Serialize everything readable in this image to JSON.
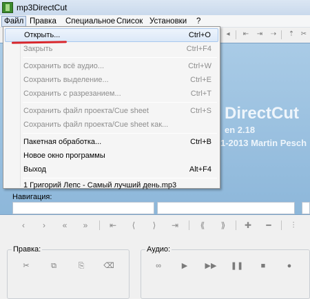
{
  "window": {
    "title": "mp3DirectCut"
  },
  "menubar": {
    "items": [
      "Файл",
      "Правка",
      "Специальное",
      "Список",
      "Установки",
      "?"
    ]
  },
  "splash": {
    "title": "DirectCut",
    "version": "en 2.18",
    "copyright": "1-2013 Martin Pesch"
  },
  "file_menu": {
    "open": {
      "label": "Открыть...",
      "shortcut": "Ctrl+O"
    },
    "close": {
      "label": "Закрыть",
      "shortcut": "Ctrl+F4"
    },
    "save_all_audio": {
      "label": "Сохранить всё аудио...",
      "shortcut": "Ctrl+W"
    },
    "save_selection": {
      "label": "Сохранить выделение...",
      "shortcut": "Ctrl+E"
    },
    "save_split": {
      "label": "Сохранить с разрезанием...",
      "shortcut": "Ctrl+T"
    },
    "save_project": {
      "label": "Сохранить файл проекта/Cue sheet",
      "shortcut": "Ctrl+S"
    },
    "save_project_as": {
      "label": "Сохранить файл проекта/Cue sheet как...",
      "shortcut": ""
    },
    "batch": {
      "label": "Пакетная обработка...",
      "shortcut": "Ctrl+B"
    },
    "new_window": {
      "label": "Новое окно программы",
      "shortcut": ""
    },
    "exit": {
      "label": "Выход",
      "shortcut": "Alt+F4"
    },
    "recent1": {
      "label": "1 Григорий Лепс - Самый лучший день.mp3",
      "shortcut": ""
    }
  },
  "navigation": {
    "label": "Навигация:"
  },
  "edit_group": {
    "label": "Правка:"
  },
  "audio_group": {
    "label": "Аудио:"
  },
  "colors": {
    "highlight_underline": "#d9262b",
    "splash_bg": "#9fc4e3"
  }
}
